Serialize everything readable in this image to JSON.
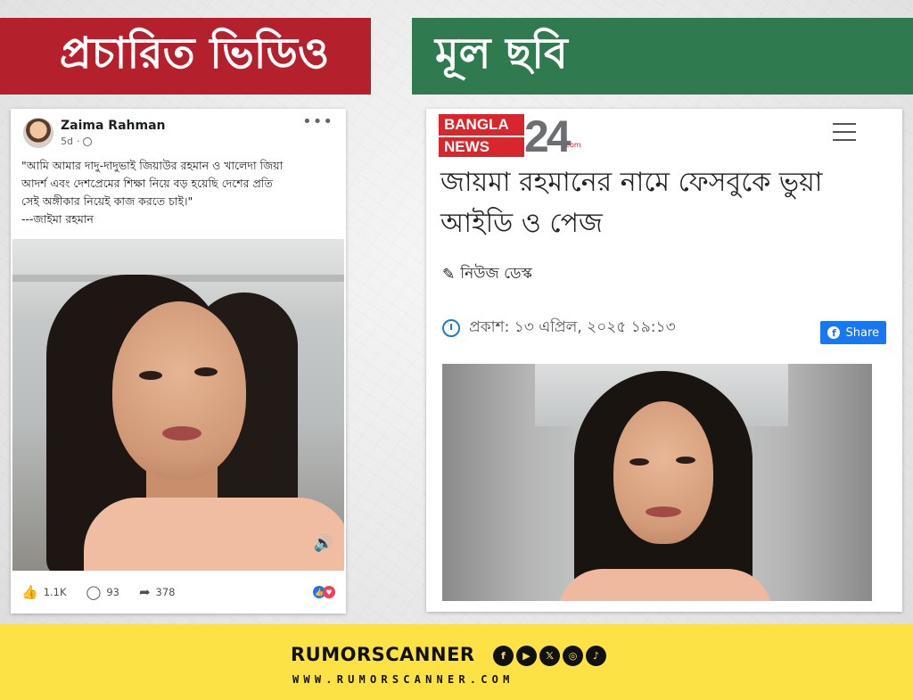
{
  "banners": {
    "left_title": "প্রচারিত ভিডিও",
    "right_title": "মূল ছবি"
  },
  "fb_post": {
    "author": "Zaima Rahman",
    "age": "5d",
    "text_line1": "\"আমি আমার দাদু-দাদুভাই জিয়াউর রহমান ও খালেদা জিয়া",
    "text_line2": "আদর্শ এবং দেশপ্রেমের শিক্ষা নিয়ে বড় হয়েছি দেশের প্রতি",
    "text_line3": "সেই অঙ্গীকার নিয়েই কাজ করতে চাই।\"",
    "text_line4": "---জাইমা রহমান",
    "likes": "1.1K",
    "comments": "93",
    "shares": "378",
    "icons": {
      "more": "more-dots-icon",
      "globe": "globe-icon",
      "like": "like-icon",
      "comment": "comment-icon",
      "share": "share-icon",
      "volume": "volume-icon"
    }
  },
  "news": {
    "logo_line1": "BANGLA",
    "logo_line2": "NEWS",
    "logo_number": "24",
    "logo_domain": ".com",
    "headline_line1": "জায়মা রহমানের নামে ফেসবুকে ভুয়া",
    "headline_line2": "আইডি ও পেজ",
    "author": "নিউজ ডেস্ক",
    "published": "প্রকাশ: ১৩ এপ্রিল, ২০২৫ ১৯:১৩",
    "share_label": "Share",
    "brand_color": "#d7262c"
  },
  "footer": {
    "brand": "RUMORSCANNER",
    "url": "WWW.RUMORSCANNER.COM",
    "social_icons": [
      "facebook-icon",
      "youtube-icon",
      "x-icon",
      "instagram-icon",
      "tiktok-icon"
    ],
    "background": "#fde245"
  },
  "colors": {
    "left_banner": "#b4202b",
    "right_banner": "#2f7a4e",
    "facebook_blue": "#1877f2"
  }
}
